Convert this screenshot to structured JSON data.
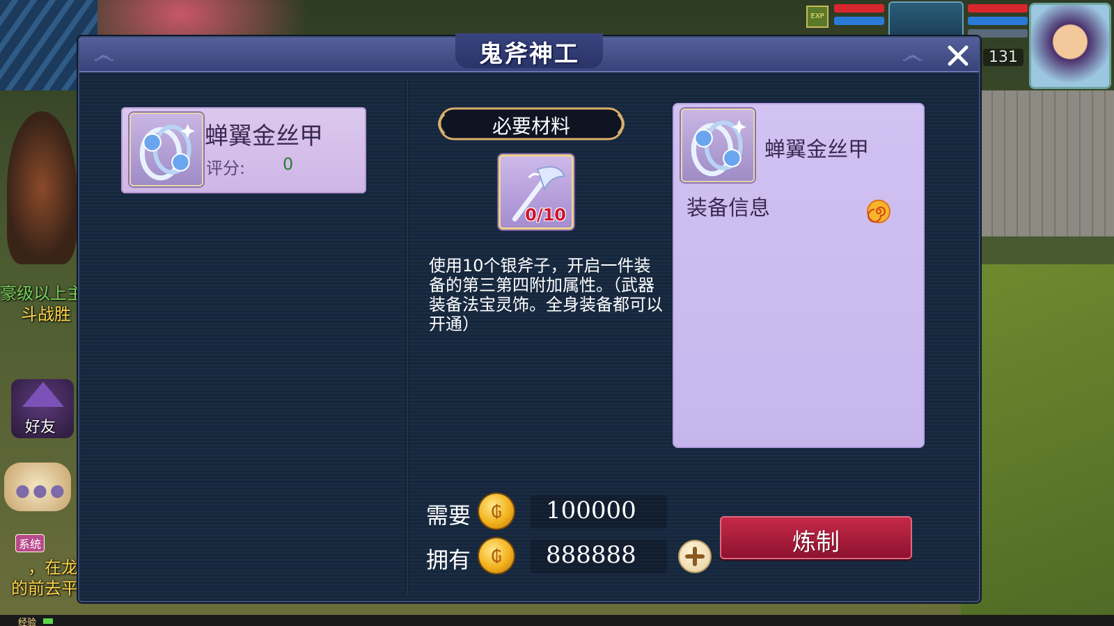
{
  "dialog": {
    "title": "鬼斧神工",
    "close_icon": "close-icon"
  },
  "left_item": {
    "name": "蝉翼金丝甲",
    "score_label": "评分:",
    "score_value": "0",
    "icon": "bracelet-icon"
  },
  "materials": {
    "banner_label": "必要材料",
    "item_icon": "silver-axe-icon",
    "count": "0/10",
    "description": "使用10个银斧子，开启一件装备的第三第四附加属性。（武器装备法宝灵饰。全身装备都可以开通）"
  },
  "info_card": {
    "item_name": "蝉翼金丝甲",
    "section_label": "装备信息",
    "icon": "bracelet-icon",
    "swirl_icon": "swirl-icon"
  },
  "cost": {
    "required_label": "需要",
    "required_value": "100000",
    "owned_label": "拥有",
    "owned_value": "888888",
    "coin_icon": "gold-coin-icon",
    "add_icon": "plus-icon"
  },
  "actions": {
    "refine_label": "炼制"
  },
  "hud": {
    "level": "131",
    "friend_label": "好友",
    "system_tag": "系统",
    "exp_label": "经验",
    "exp_badge": "EXP",
    "side_text_1": "豪级以上主",
    "side_text_2": "斗战胜",
    "chat_line_1": "，在龙宫",
    "chat_line_2": "的前去平",
    "hp_color": "#d8262e",
    "mp_color": "#2a7ad8"
  },
  "colors": {
    "dialog_bg": "#16263b",
    "header": "#4a5590",
    "card_bg": "#d2c2f2",
    "refine_button": "#b01e3c",
    "count_text": "#d0142a",
    "score_text": "#2e7a3a"
  }
}
